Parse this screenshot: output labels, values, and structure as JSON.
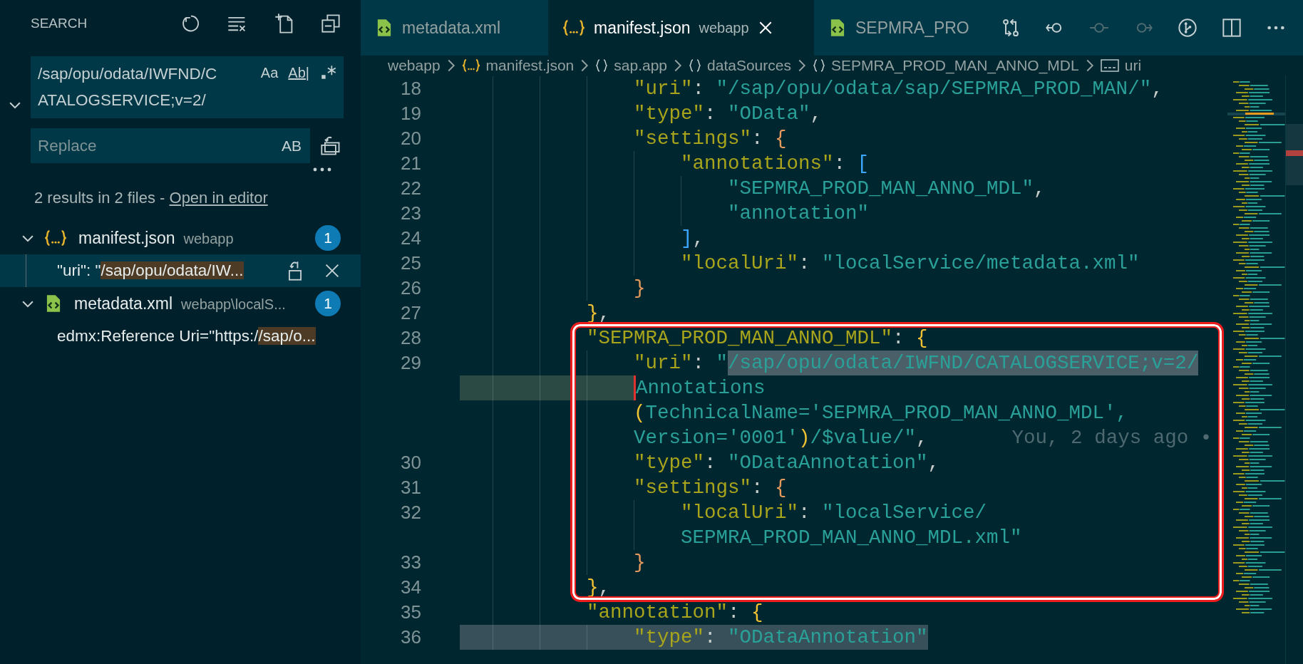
{
  "sidebar": {
    "title": "SEARCH",
    "search": {
      "value": "/sap/opu/odata/IWFND/CATALOGSERVICE;v=2/",
      "options": [
        "Aa",
        "Ab|"
      ]
    },
    "replace": {
      "placeholder": "Replace",
      "option": "AB"
    },
    "summary": "2 results in 2 files - ",
    "summary_link": "Open in editor",
    "results": [
      {
        "kind": "json",
        "file": "manifest.json",
        "folder": "webapp",
        "count": "1",
        "expanded": true,
        "matches": [
          {
            "prefix": "\"uri\": \"",
            "match": "/sap/opu/odata/IW...",
            "selected": true
          }
        ]
      },
      {
        "kind": "xml",
        "file": "metadata.xml",
        "folder": "webapp\\localS...",
        "count": "1",
        "expanded": true,
        "matches": [
          {
            "prefix": "edmx:Reference Uri=\"https:/",
            "match": "/sap/o...",
            "selected": false
          }
        ]
      }
    ]
  },
  "tabs": [
    {
      "kind": "xml",
      "label": "metadata.xml",
      "selected": false
    },
    {
      "kind": "json",
      "label": "manifest.json",
      "description": "webapp",
      "selected": true
    },
    {
      "kind": "xml",
      "label": "SEPMRA_PRO",
      "selected": false
    }
  ],
  "toolbar": [
    {
      "kind": "compare",
      "disabled": false
    },
    {
      "kind": "back",
      "disabled": false
    },
    {
      "kind": "commit",
      "disabled": true
    },
    {
      "kind": "forward",
      "disabled": true
    },
    {
      "kind": "graph",
      "disabled": false
    },
    {
      "kind": "split",
      "disabled": false
    },
    {
      "kind": "more",
      "disabled": false
    }
  ],
  "breadcrumbs": [
    {
      "kind": "folder",
      "label": "webapp"
    },
    {
      "kind": "json",
      "label": "manifest.json"
    },
    {
      "kind": "object",
      "label": "sap.app"
    },
    {
      "kind": "object",
      "label": "dataSources"
    },
    {
      "kind": "object",
      "label": "SEPMRA_PROD_MAN_ANNO_MDL"
    },
    {
      "kind": "string",
      "label": "uri"
    }
  ],
  "editor": {
    "rows": [
      {
        "number": "18",
        "tokens": [
          {
            "kind": "key",
            "text": "            \"uri\""
          },
          {
            "kind": "punct",
            "text": ": "
          },
          {
            "kind": "string",
            "text": "\"/sap/opu/odata/sap/SEPMRA_PROD_MAN/\""
          },
          {
            "kind": "punct",
            "text": ","
          }
        ]
      },
      {
        "number": "19",
        "tokens": [
          {
            "kind": "key",
            "text": "            \"type\""
          },
          {
            "kind": "punct",
            "text": ": "
          },
          {
            "kind": "string",
            "text": "\"OData\""
          },
          {
            "kind": "punct",
            "text": ","
          }
        ]
      },
      {
        "number": "20",
        "tokens": [
          {
            "kind": "key",
            "text": "            \"settings\""
          },
          {
            "kind": "punct",
            "text": ": "
          },
          {
            "kind": "bracket-peach",
            "text": "{"
          }
        ]
      },
      {
        "number": "21",
        "tokens": [
          {
            "kind": "key",
            "text": "                \"annotations\""
          },
          {
            "kind": "punct",
            "text": ": "
          },
          {
            "kind": "bracket-blue",
            "text": "["
          }
        ]
      },
      {
        "number": "22",
        "tokens": [
          {
            "kind": "string",
            "text": "                    \"SEPMRA_PROD_MAN_ANNO_MDL\""
          },
          {
            "kind": "punct",
            "text": ","
          }
        ]
      },
      {
        "number": "23",
        "tokens": [
          {
            "kind": "string",
            "text": "                    \"annotation\""
          }
        ]
      },
      {
        "number": "24",
        "tokens": [
          {
            "kind": "bracket-blue",
            "text": "                ]"
          },
          {
            "kind": "punct",
            "text": ","
          }
        ]
      },
      {
        "number": "25",
        "tokens": [
          {
            "kind": "key",
            "text": "                \"localUri\""
          },
          {
            "kind": "punct",
            "text": ": "
          },
          {
            "kind": "string",
            "text": "\"localService/metadata.xml\""
          }
        ]
      },
      {
        "number": "26",
        "tokens": [
          {
            "kind": "bracket-peach",
            "text": "            }"
          }
        ]
      },
      {
        "number": "27",
        "tokens": [
          {
            "kind": "bracket-gold",
            "text": "        }"
          },
          {
            "kind": "punct",
            "text": ","
          }
        ]
      },
      {
        "number": "28",
        "tokens": [
          {
            "kind": "key",
            "text": "        \"SEPMRA_PROD_MAN_ANNO_MDL\""
          },
          {
            "kind": "punct",
            "text": ": "
          },
          {
            "kind": "bracket-gold",
            "text": "{"
          }
        ]
      },
      {
        "number": "29",
        "tokens": [
          {
            "kind": "key",
            "text": "            \"uri\""
          },
          {
            "kind": "punct",
            "text": ": "
          },
          {
            "kind": "string",
            "text": "\""
          },
          {
            "kind": "match",
            "text": "/sap/opu/odata/IWFND/CATALOGSERVICE;v=2/"
          }
        ]
      },
      {
        "cursor": true,
        "tokens": [
          {
            "kind": "string",
            "text": "            Annotations"
          }
        ]
      },
      {
        "tokens": [
          {
            "kind": "bracket-gold",
            "text": "            ("
          },
          {
            "kind": "string",
            "text": "TechnicalName='SEPMRA_PROD_MAN_ANNO_MDL',"
          }
        ]
      },
      {
        "tokens": [
          {
            "kind": "string",
            "text": "            Version='0001'"
          },
          {
            "kind": "bracket-gold",
            "text": ")"
          },
          {
            "kind": "string",
            "text": "/$value/\""
          },
          {
            "kind": "punct",
            "text": ","
          },
          {
            "kind": "blame",
            "text": "You, 2 days ago •"
          }
        ]
      },
      {
        "number": "30",
        "tokens": [
          {
            "kind": "key",
            "text": "            \"type\""
          },
          {
            "kind": "punct",
            "text": ": "
          },
          {
            "kind": "string",
            "text": "\"ODataAnnotation\""
          },
          {
            "kind": "punct",
            "text": ","
          }
        ]
      },
      {
        "number": "31",
        "tokens": [
          {
            "kind": "key",
            "text": "            \"settings\""
          },
          {
            "kind": "punct",
            "text": ": "
          },
          {
            "kind": "bracket-peach",
            "text": "{"
          }
        ]
      },
      {
        "number": "32",
        "tokens": [
          {
            "kind": "key",
            "text": "                \"localUri\""
          },
          {
            "kind": "punct",
            "text": ": "
          },
          {
            "kind": "string",
            "text": "\"localService/"
          }
        ]
      },
      {
        "tokens": [
          {
            "kind": "string",
            "text": "                SEPMRA_PROD_MAN_ANNO_MDL.xml\""
          }
        ]
      },
      {
        "number": "33",
        "tokens": [
          {
            "kind": "bracket-peach",
            "text": "            }"
          }
        ]
      },
      {
        "number": "34",
        "tokens": [
          {
            "kind": "bracket-gold",
            "text": "        }"
          },
          {
            "kind": "punct",
            "text": ","
          }
        ]
      },
      {
        "number": "35",
        "tokens": [
          {
            "kind": "key",
            "text": "        \"annotation\""
          },
          {
            "kind": "punct",
            "text": ": "
          },
          {
            "kind": "bracket-gold",
            "text": "{"
          }
        ]
      },
      {
        "number": "36",
        "highlighted": true,
        "tokens": [
          {
            "kind": "key",
            "text": "            \"type\""
          },
          {
            "kind": "punct",
            "text": ": "
          },
          {
            "kind": "string",
            "text": "\"ODataAnnotation\""
          }
        ]
      }
    ]
  }
}
